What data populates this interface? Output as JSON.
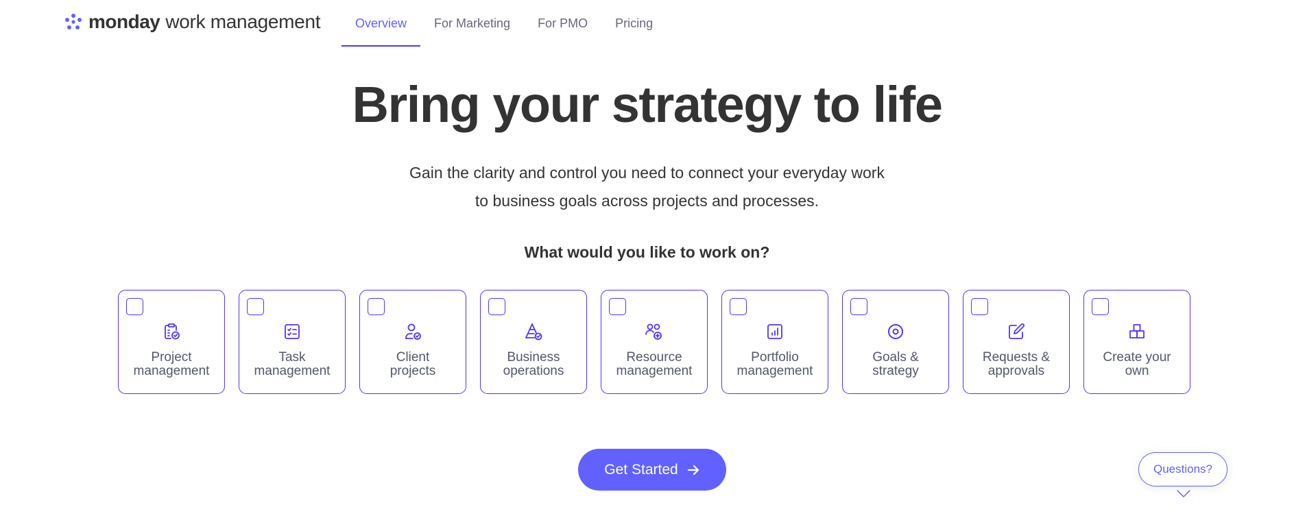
{
  "header": {
    "brand": "monday",
    "product": "work management",
    "nav": [
      {
        "label": "Overview",
        "active": true
      },
      {
        "label": "For Marketing",
        "active": false
      },
      {
        "label": "For PMO",
        "active": false
      },
      {
        "label": "Pricing",
        "active": false
      }
    ]
  },
  "hero": {
    "title": "Bring your strategy to life",
    "subtitle_line1": "Gain the clarity and control you need to connect your everyday work",
    "subtitle_line2": "to business goals across projects and processes."
  },
  "question": "What would you like to work on?",
  "cards": [
    {
      "line1": "Project",
      "line2": "management",
      "icon": "clipboard-check-icon",
      "checked": false
    },
    {
      "line1": "Task",
      "line2": "management",
      "icon": "checklist-icon",
      "checked": false
    },
    {
      "line1": "Client",
      "line2": "projects",
      "icon": "user-check-icon",
      "checked": false
    },
    {
      "line1": "Business",
      "line2": "operations",
      "icon": "pyramid-check-icon",
      "checked": false
    },
    {
      "line1": "Resource",
      "line2": "management",
      "icon": "users-add-icon",
      "checked": false
    },
    {
      "line1": "Portfolio",
      "line2": "management",
      "icon": "bar-chart-icon",
      "checked": false
    },
    {
      "line1": "Goals &",
      "line2": "strategy",
      "icon": "target-icon",
      "checked": false
    },
    {
      "line1": "Requests &",
      "line2": "approvals",
      "icon": "edit-icon",
      "checked": false
    },
    {
      "line1": "Create your",
      "line2": "own",
      "icon": "blocks-icon",
      "checked": false
    }
  ],
  "cta": {
    "label": "Get Started",
    "icon": "arrow-right-icon"
  },
  "help": {
    "label": "Questions?",
    "icon": "chevron-down-icon"
  },
  "colors": {
    "accent": "#6161ff",
    "accent_dark": "#5034ff",
    "text": "#333333",
    "muted": "#676879"
  }
}
